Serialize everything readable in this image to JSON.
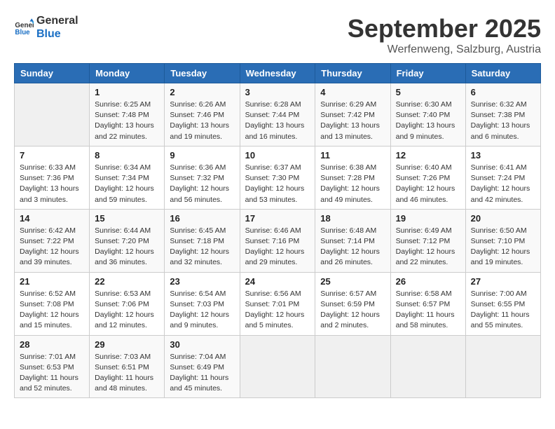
{
  "logo": {
    "general": "General",
    "blue": "Blue"
  },
  "title": "September 2025",
  "subtitle": "Werfenweng, Salzburg, Austria",
  "days_of_week": [
    "Sunday",
    "Monday",
    "Tuesday",
    "Wednesday",
    "Thursday",
    "Friday",
    "Saturday"
  ],
  "weeks": [
    [
      {
        "day": "",
        "info": ""
      },
      {
        "day": "1",
        "info": "Sunrise: 6:25 AM\nSunset: 7:48 PM\nDaylight: 13 hours\nand 22 minutes."
      },
      {
        "day": "2",
        "info": "Sunrise: 6:26 AM\nSunset: 7:46 PM\nDaylight: 13 hours\nand 19 minutes."
      },
      {
        "day": "3",
        "info": "Sunrise: 6:28 AM\nSunset: 7:44 PM\nDaylight: 13 hours\nand 16 minutes."
      },
      {
        "day": "4",
        "info": "Sunrise: 6:29 AM\nSunset: 7:42 PM\nDaylight: 13 hours\nand 13 minutes."
      },
      {
        "day": "5",
        "info": "Sunrise: 6:30 AM\nSunset: 7:40 PM\nDaylight: 13 hours\nand 9 minutes."
      },
      {
        "day": "6",
        "info": "Sunrise: 6:32 AM\nSunset: 7:38 PM\nDaylight: 13 hours\nand 6 minutes."
      }
    ],
    [
      {
        "day": "7",
        "info": "Sunrise: 6:33 AM\nSunset: 7:36 PM\nDaylight: 13 hours\nand 3 minutes."
      },
      {
        "day": "8",
        "info": "Sunrise: 6:34 AM\nSunset: 7:34 PM\nDaylight: 12 hours\nand 59 minutes."
      },
      {
        "day": "9",
        "info": "Sunrise: 6:36 AM\nSunset: 7:32 PM\nDaylight: 12 hours\nand 56 minutes."
      },
      {
        "day": "10",
        "info": "Sunrise: 6:37 AM\nSunset: 7:30 PM\nDaylight: 12 hours\nand 53 minutes."
      },
      {
        "day": "11",
        "info": "Sunrise: 6:38 AM\nSunset: 7:28 PM\nDaylight: 12 hours\nand 49 minutes."
      },
      {
        "day": "12",
        "info": "Sunrise: 6:40 AM\nSunset: 7:26 PM\nDaylight: 12 hours\nand 46 minutes."
      },
      {
        "day": "13",
        "info": "Sunrise: 6:41 AM\nSunset: 7:24 PM\nDaylight: 12 hours\nand 42 minutes."
      }
    ],
    [
      {
        "day": "14",
        "info": "Sunrise: 6:42 AM\nSunset: 7:22 PM\nDaylight: 12 hours\nand 39 minutes."
      },
      {
        "day": "15",
        "info": "Sunrise: 6:44 AM\nSunset: 7:20 PM\nDaylight: 12 hours\nand 36 minutes."
      },
      {
        "day": "16",
        "info": "Sunrise: 6:45 AM\nSunset: 7:18 PM\nDaylight: 12 hours\nand 32 minutes."
      },
      {
        "day": "17",
        "info": "Sunrise: 6:46 AM\nSunset: 7:16 PM\nDaylight: 12 hours\nand 29 minutes."
      },
      {
        "day": "18",
        "info": "Sunrise: 6:48 AM\nSunset: 7:14 PM\nDaylight: 12 hours\nand 26 minutes."
      },
      {
        "day": "19",
        "info": "Sunrise: 6:49 AM\nSunset: 7:12 PM\nDaylight: 12 hours\nand 22 minutes."
      },
      {
        "day": "20",
        "info": "Sunrise: 6:50 AM\nSunset: 7:10 PM\nDaylight: 12 hours\nand 19 minutes."
      }
    ],
    [
      {
        "day": "21",
        "info": "Sunrise: 6:52 AM\nSunset: 7:08 PM\nDaylight: 12 hours\nand 15 minutes."
      },
      {
        "day": "22",
        "info": "Sunrise: 6:53 AM\nSunset: 7:06 PM\nDaylight: 12 hours\nand 12 minutes."
      },
      {
        "day": "23",
        "info": "Sunrise: 6:54 AM\nSunset: 7:03 PM\nDaylight: 12 hours\nand 9 minutes."
      },
      {
        "day": "24",
        "info": "Sunrise: 6:56 AM\nSunset: 7:01 PM\nDaylight: 12 hours\nand 5 minutes."
      },
      {
        "day": "25",
        "info": "Sunrise: 6:57 AM\nSunset: 6:59 PM\nDaylight: 12 hours\nand 2 minutes."
      },
      {
        "day": "26",
        "info": "Sunrise: 6:58 AM\nSunset: 6:57 PM\nDaylight: 11 hours\nand 58 minutes."
      },
      {
        "day": "27",
        "info": "Sunrise: 7:00 AM\nSunset: 6:55 PM\nDaylight: 11 hours\nand 55 minutes."
      }
    ],
    [
      {
        "day": "28",
        "info": "Sunrise: 7:01 AM\nSunset: 6:53 PM\nDaylight: 11 hours\nand 52 minutes."
      },
      {
        "day": "29",
        "info": "Sunrise: 7:03 AM\nSunset: 6:51 PM\nDaylight: 11 hours\nand 48 minutes."
      },
      {
        "day": "30",
        "info": "Sunrise: 7:04 AM\nSunset: 6:49 PM\nDaylight: 11 hours\nand 45 minutes."
      },
      {
        "day": "",
        "info": ""
      },
      {
        "day": "",
        "info": ""
      },
      {
        "day": "",
        "info": ""
      },
      {
        "day": "",
        "info": ""
      }
    ]
  ]
}
